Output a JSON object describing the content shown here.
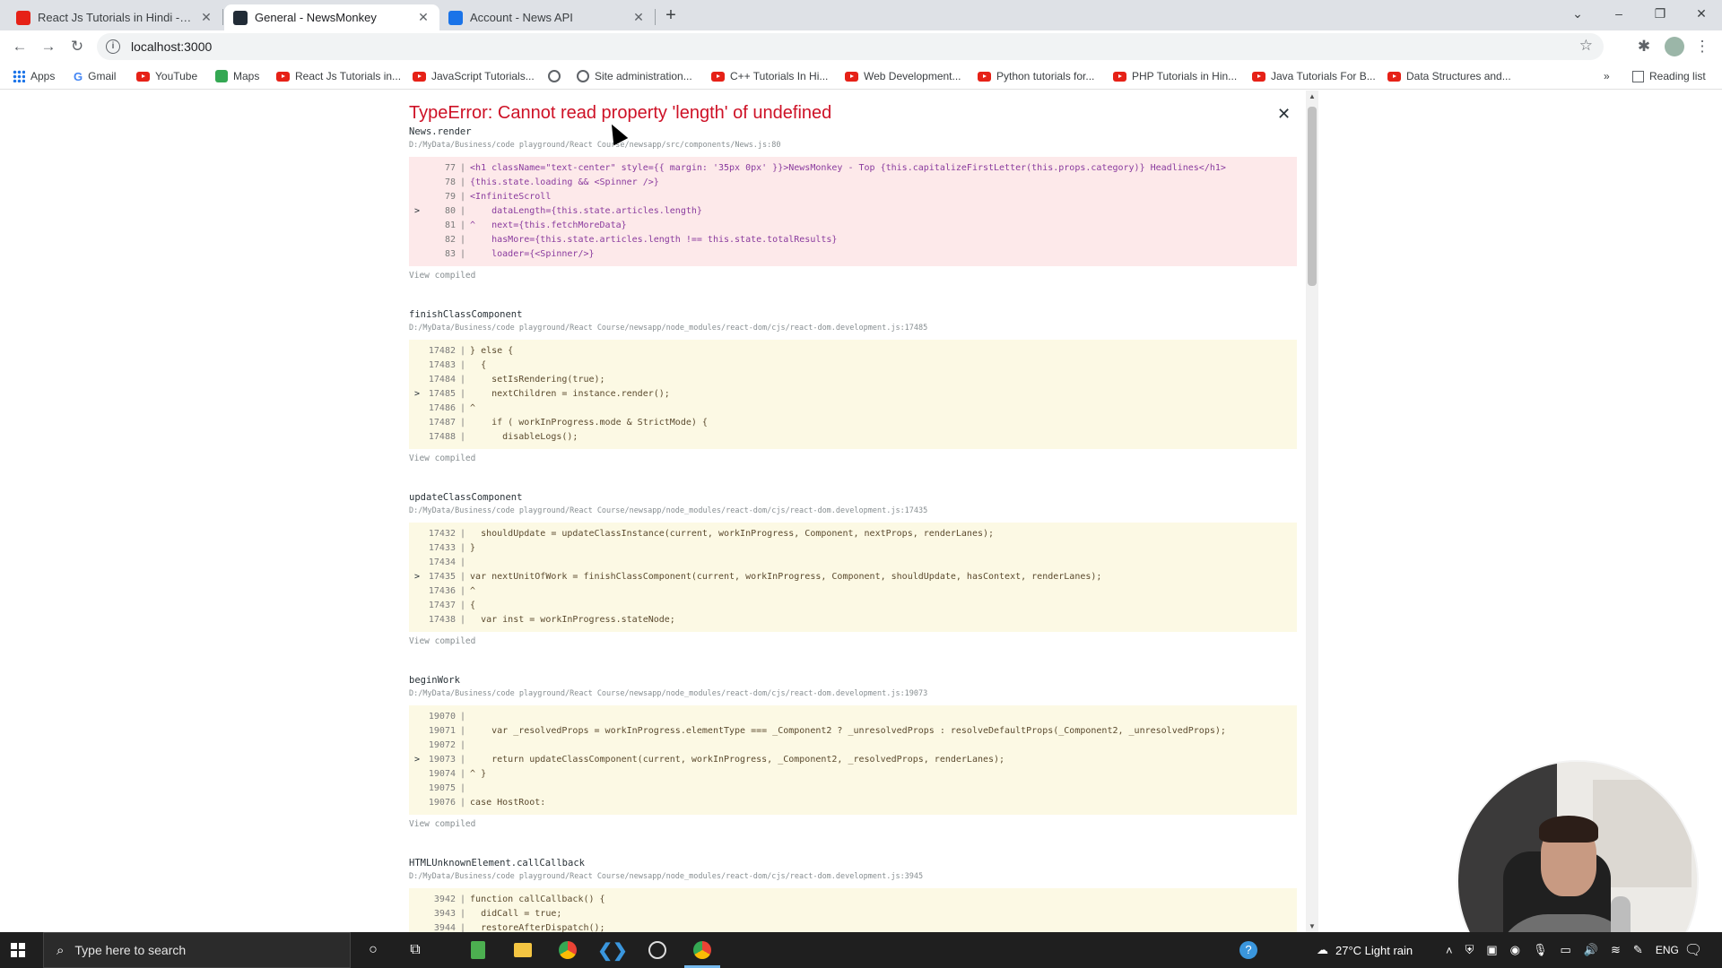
{
  "browser": {
    "tabs": [
      {
        "label": "React Js Tutorials in Hindi - YouT",
        "favicon_color": "#e62117"
      },
      {
        "label": "General - NewsMonkey",
        "favicon_color": "#222c37"
      },
      {
        "label": "Account - News API",
        "favicon_color": "#1a73e8"
      }
    ],
    "url": "localhost:3000"
  },
  "bookmarks": [
    {
      "label": "Apps",
      "icon": "apps-grid-icon"
    },
    {
      "label": "Gmail",
      "icon": "google-icon"
    },
    {
      "label": "YouTube",
      "icon": "youtube-icon"
    },
    {
      "label": "Maps",
      "icon": "maps-icon"
    },
    {
      "label": "React Js Tutorials in...",
      "icon": "youtube-icon"
    },
    {
      "label": "JavaScript Tutorials...",
      "icon": "youtube-icon"
    },
    {
      "label": "",
      "icon": "globe-icon"
    },
    {
      "label": "Site administration...",
      "icon": "globe-icon"
    },
    {
      "label": "C++ Tutorials In Hi...",
      "icon": "youtube-icon"
    },
    {
      "label": "Web Development...",
      "icon": "youtube-icon"
    },
    {
      "label": "Python tutorials for...",
      "icon": "youtube-icon"
    },
    {
      "label": "PHP Tutorials in Hin...",
      "icon": "youtube-icon"
    },
    {
      "label": "Java Tutorials For B...",
      "icon": "youtube-icon"
    },
    {
      "label": "Data Structures and...",
      "icon": "youtube-icon"
    }
  ],
  "reading_list": "Reading list",
  "error": {
    "title": "TypeError: Cannot read property 'length' of undefined",
    "view_compiled": "View compiled",
    "frames": [
      {
        "name": "News.render",
        "path": "D:/MyData/Business/code playground/React Course/newsapp/src/components/News.js:80",
        "style": "red",
        "lines": [
          {
            "n": "77",
            "m": "",
            "t": "<h1 className=\"text-center\" style={{ margin: '35px 0px' }}>NewsMonkey - Top {this.capitalizeFirstLetter(this.props.category)} Headlines</h1>"
          },
          {
            "n": "78",
            "m": "",
            "t": "{this.state.loading && <Spinner />}"
          },
          {
            "n": "79",
            "m": "",
            "t": "<InfiniteScroll"
          },
          {
            "n": "80",
            "m": ">",
            "t": "    dataLength={this.state.articles.length}"
          },
          {
            "n": "81",
            "m": "",
            "t": "^   next={this.fetchMoreData}"
          },
          {
            "n": "82",
            "m": "",
            "t": "    hasMore={this.state.articles.length !== this.state.totalResults}"
          },
          {
            "n": "83",
            "m": "",
            "t": "    loader={<Spinner/>}"
          }
        ]
      },
      {
        "name": "finishClassComponent",
        "path": "D:/MyData/Business/code playground/React Course/newsapp/node_modules/react-dom/cjs/react-dom.development.js:17485",
        "style": "yel",
        "lines": [
          {
            "n": "17482",
            "m": "",
            "t": "} else {"
          },
          {
            "n": "17483",
            "m": "",
            "t": "  {"
          },
          {
            "n": "17484",
            "m": "",
            "t": "    setIsRendering(true);"
          },
          {
            "n": "17485",
            "m": ">",
            "t": "    nextChildren = instance.render();"
          },
          {
            "n": "17486",
            "m": "",
            "t": "^"
          },
          {
            "n": "17487",
            "m": "",
            "t": "    if ( workInProgress.mode & StrictMode) {"
          },
          {
            "n": "17488",
            "m": "",
            "t": "      disableLogs();"
          }
        ]
      },
      {
        "name": "updateClassComponent",
        "path": "D:/MyData/Business/code playground/React Course/newsapp/node_modules/react-dom/cjs/react-dom.development.js:17435",
        "style": "yel",
        "lines": [
          {
            "n": "17432",
            "m": "",
            "t": "  shouldUpdate = updateClassInstance(current, workInProgress, Component, nextProps, renderLanes);"
          },
          {
            "n": "17433",
            "m": "",
            "t": "}"
          },
          {
            "n": "17434",
            "m": "",
            "t": ""
          },
          {
            "n": "17435",
            "m": ">",
            "t": "var nextUnitOfWork = finishClassComponent(current, workInProgress, Component, shouldUpdate, hasContext, renderLanes);"
          },
          {
            "n": "17436",
            "m": "",
            "t": "^"
          },
          {
            "n": "17437",
            "m": "",
            "t": "{"
          },
          {
            "n": "17438",
            "m": "",
            "t": "  var inst = workInProgress.stateNode;"
          }
        ]
      },
      {
        "name": "beginWork",
        "path": "D:/MyData/Business/code playground/React Course/newsapp/node_modules/react-dom/cjs/react-dom.development.js:19073",
        "style": "yel",
        "lines": [
          {
            "n": "19070",
            "m": "",
            "t": ""
          },
          {
            "n": "19071",
            "m": "",
            "t": "    var _resolvedProps = workInProgress.elementType === _Component2 ? _unresolvedProps : resolveDefaultProps(_Component2, _unresolvedProps);"
          },
          {
            "n": "19072",
            "m": "",
            "t": ""
          },
          {
            "n": "19073",
            "m": ">",
            "t": "    return updateClassComponent(current, workInProgress, _Component2, _resolvedProps, renderLanes);"
          },
          {
            "n": "19074",
            "m": "",
            "t": "^ }"
          },
          {
            "n": "19075",
            "m": "",
            "t": ""
          },
          {
            "n": "19076",
            "m": "",
            "t": "case HostRoot:"
          }
        ]
      },
      {
        "name": "HTMLUnknownElement.callCallback",
        "path": "D:/MyData/Business/code playground/React Course/newsapp/node_modules/react-dom/cjs/react-dom.development.js:3945",
        "style": "yel",
        "lines": [
          {
            "n": "3942",
            "m": "",
            "t": "function callCallback() {"
          },
          {
            "n": "3943",
            "m": "",
            "t": "  didCall = true;"
          },
          {
            "n": "3944",
            "m": "",
            "t": "  restoreAfterDispatch();"
          }
        ]
      }
    ]
  },
  "taskbar": {
    "search_placeholder": "Type here to search",
    "weather": "27°C  Light rain",
    "lang": "ENG"
  }
}
